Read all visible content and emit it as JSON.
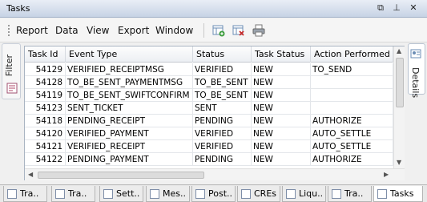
{
  "window": {
    "title": "Tasks"
  },
  "menu": [
    "Report",
    "Data",
    "View",
    "Export",
    "Window"
  ],
  "toolbar_icons": [
    "add-grid-icon",
    "delete-grid-icon",
    "print-icon"
  ],
  "side": {
    "filter_label": "Filter",
    "details_label": "Details"
  },
  "table": {
    "columns": [
      "Task Id",
      "Event Type",
      "Status",
      "Task Status",
      "Action Performed"
    ],
    "rows": [
      [
        "54129",
        "VERIFIED_RECEIPTMSG",
        "VERIFIED",
        "NEW",
        "TO_SEND"
      ],
      [
        "54128",
        "TO_BE_SENT_PAYMENTMSG",
        "TO_BE_SENT",
        "NEW",
        ""
      ],
      [
        "54119",
        "TO_BE_SENT_SWIFTCONFIRM",
        "TO_BE_SENT",
        "NEW",
        ""
      ],
      [
        "54123",
        "SENT_TICKET",
        "SENT",
        "NEW",
        ""
      ],
      [
        "54118",
        "PENDING_RECEIPT",
        "PENDING",
        "NEW",
        "AUTHORIZE"
      ],
      [
        "54120",
        "VERIFIED_PAYMENT",
        "VERIFIED",
        "NEW",
        "AUTO_SETTLE"
      ],
      [
        "54121",
        "VERIFIED_RECEIPT",
        "VERIFIED",
        "NEW",
        "AUTO_SETTLE"
      ],
      [
        "54122",
        "PENDING_PAYMENT",
        "PENDING",
        "NEW",
        "AUTHORIZE"
      ]
    ]
  },
  "tabs": [
    {
      "label": "Tra..",
      "active": false
    },
    {
      "label": "Tra..",
      "active": false
    },
    {
      "label": "Sett..",
      "active": false
    },
    {
      "label": "Mes..",
      "active": false
    },
    {
      "label": "Post..",
      "active": false
    },
    {
      "label": "CREs",
      "active": false
    },
    {
      "label": "Liqu..",
      "active": false
    },
    {
      "label": "Tra..",
      "active": false
    },
    {
      "label": "Tasks",
      "active": true
    }
  ]
}
